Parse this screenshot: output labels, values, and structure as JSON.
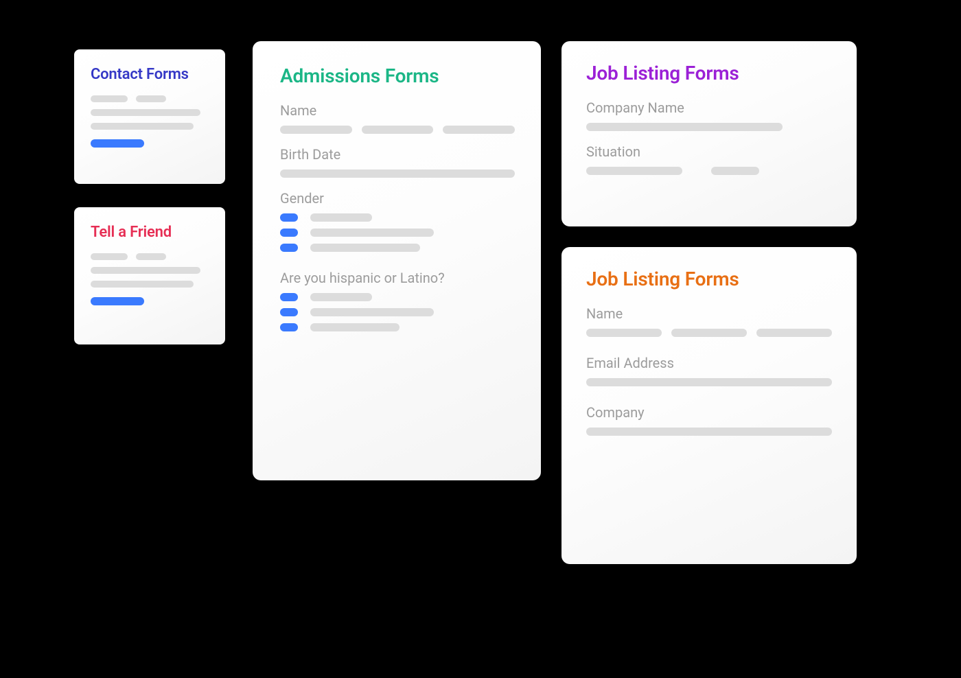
{
  "cards": {
    "contact": {
      "title": "Contact Forms",
      "title_color": "#3538c6"
    },
    "tell": {
      "title": "Tell a Friend",
      "title_color": "#e62e54"
    },
    "admissions": {
      "title": "Admissions Forms",
      "title_color": "#1bb686",
      "fields": {
        "name": "Name",
        "birth_date": "Birth Date",
        "gender": "Gender",
        "hispanic": "Are you hispanic or Latino?"
      }
    },
    "job1": {
      "title": "Job Listing Forms",
      "title_color": "#9b20d6",
      "fields": {
        "company_name": "Company Name",
        "situation": "Situation"
      }
    },
    "job2": {
      "title": "Job Listing Forms",
      "title_color": "#e86f14",
      "fields": {
        "name": "Name",
        "email": "Email Address",
        "company": "Company"
      }
    }
  }
}
